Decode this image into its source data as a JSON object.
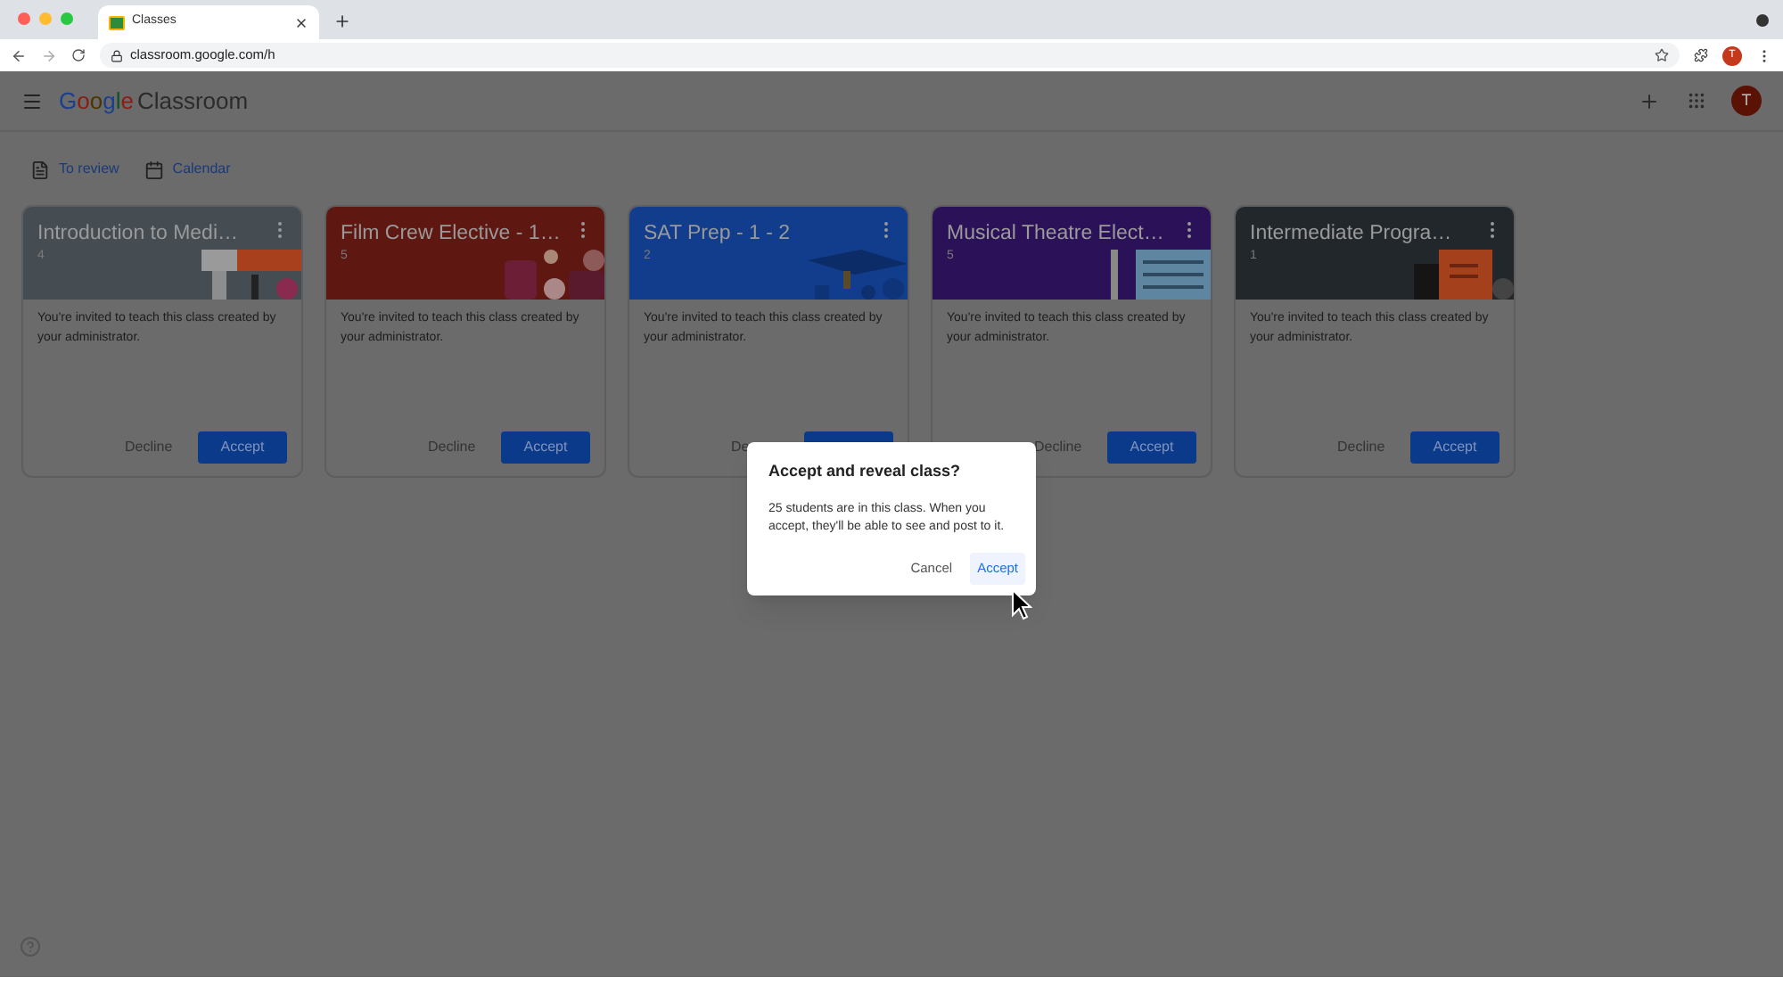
{
  "browser": {
    "tab_title": "Classes",
    "url": "classroom.google.com/h",
    "avatar": "T"
  },
  "app": {
    "logo": "Google",
    "product": "Classroom",
    "avatar": "T"
  },
  "nav_links": [
    {
      "label": "To review",
      "kind": "review"
    },
    {
      "label": "Calendar",
      "kind": "calendar"
    }
  ],
  "classes": [
    {
      "title": "Introduction to Medi…",
      "section": "4",
      "color": "#454c52",
      "invite": "You're invited to teach this class created by your administrator.",
      "decline": "Decline",
      "accept": "Accept"
    },
    {
      "title": "Film Crew Elective - 1…",
      "section": "5",
      "color": "#5e1711",
      "invite": "You're invited to teach this class created by your administrator.",
      "decline": "Decline",
      "accept": "Accept"
    },
    {
      "title": "SAT Prep - 1 - 2",
      "section": "2",
      "color": "#113d8c",
      "invite": "You're invited to teach this class created by your administrator.",
      "decline": "De"
    },
    {
      "title": "Musical Theatre Elect…",
      "section": "5",
      "color": "#2b1158",
      "invite": "You're invited to teach this class created by your administrator.",
      "decline": "Decline",
      "accept": "Accept"
    },
    {
      "title": "Intermediate Progra…",
      "section": "1",
      "color": "#22272b",
      "invite": "You're invited to teach this class created by your administrator.",
      "decline": "Decline",
      "accept": "Accept"
    }
  ],
  "dialog": {
    "title": "Accept and reveal class?",
    "body": "25 students are in this class. When you accept, they'll be able to see and post to it.",
    "cancel": "Cancel",
    "accept": "Accept"
  }
}
